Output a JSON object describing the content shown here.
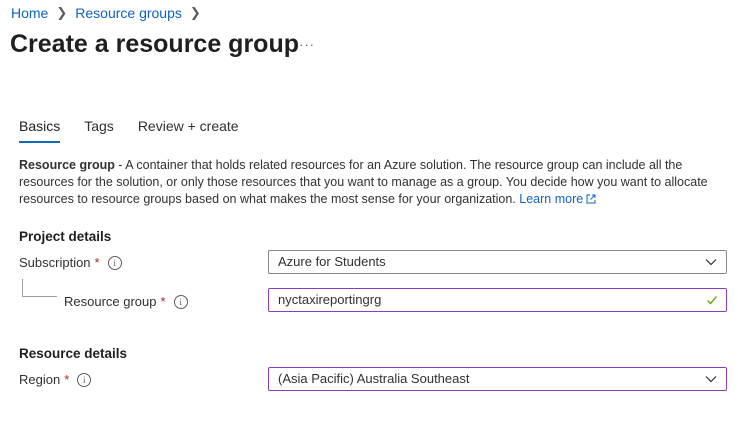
{
  "breadcrumb": [
    {
      "label": "Home"
    },
    {
      "label": "Resource groups"
    }
  ],
  "page": {
    "title": "Create a resource group",
    "more_actions": "···"
  },
  "tabs": [
    {
      "label": "Basics",
      "active": true
    },
    {
      "label": "Tags",
      "active": false
    },
    {
      "label": "Review + create",
      "active": false
    }
  ],
  "description": {
    "term": "Resource group",
    "text": " - A container that holds related resources for an Azure solution. The resource group can include all the resources for the solution, or only those resources that you want to manage as a group. You decide how you want to allocate resources to resource groups based on what makes the most sense for your organization. ",
    "link": "Learn more"
  },
  "project_details": {
    "heading": "Project details",
    "subscription": {
      "label": "Subscription",
      "required": "*",
      "value": "Azure for Students"
    },
    "resource_group": {
      "label": "Resource group",
      "required": "*",
      "value": "nyctaxireportingrg"
    }
  },
  "resource_details": {
    "heading": "Resource details",
    "region": {
      "label": "Region",
      "required": "*",
      "value": "(Asia Pacific) Australia Southeast"
    }
  },
  "icons": {
    "info": "info-icon",
    "chevron": "chevron-down-icon",
    "check": "checkmark-icon",
    "external": "external-link-icon"
  },
  "colors": {
    "link": "#0f62c4",
    "required": "#a4262c",
    "focus_border": "#8b3fb5",
    "valid": "#57a300",
    "tab_underline": "#0f6cbd"
  }
}
